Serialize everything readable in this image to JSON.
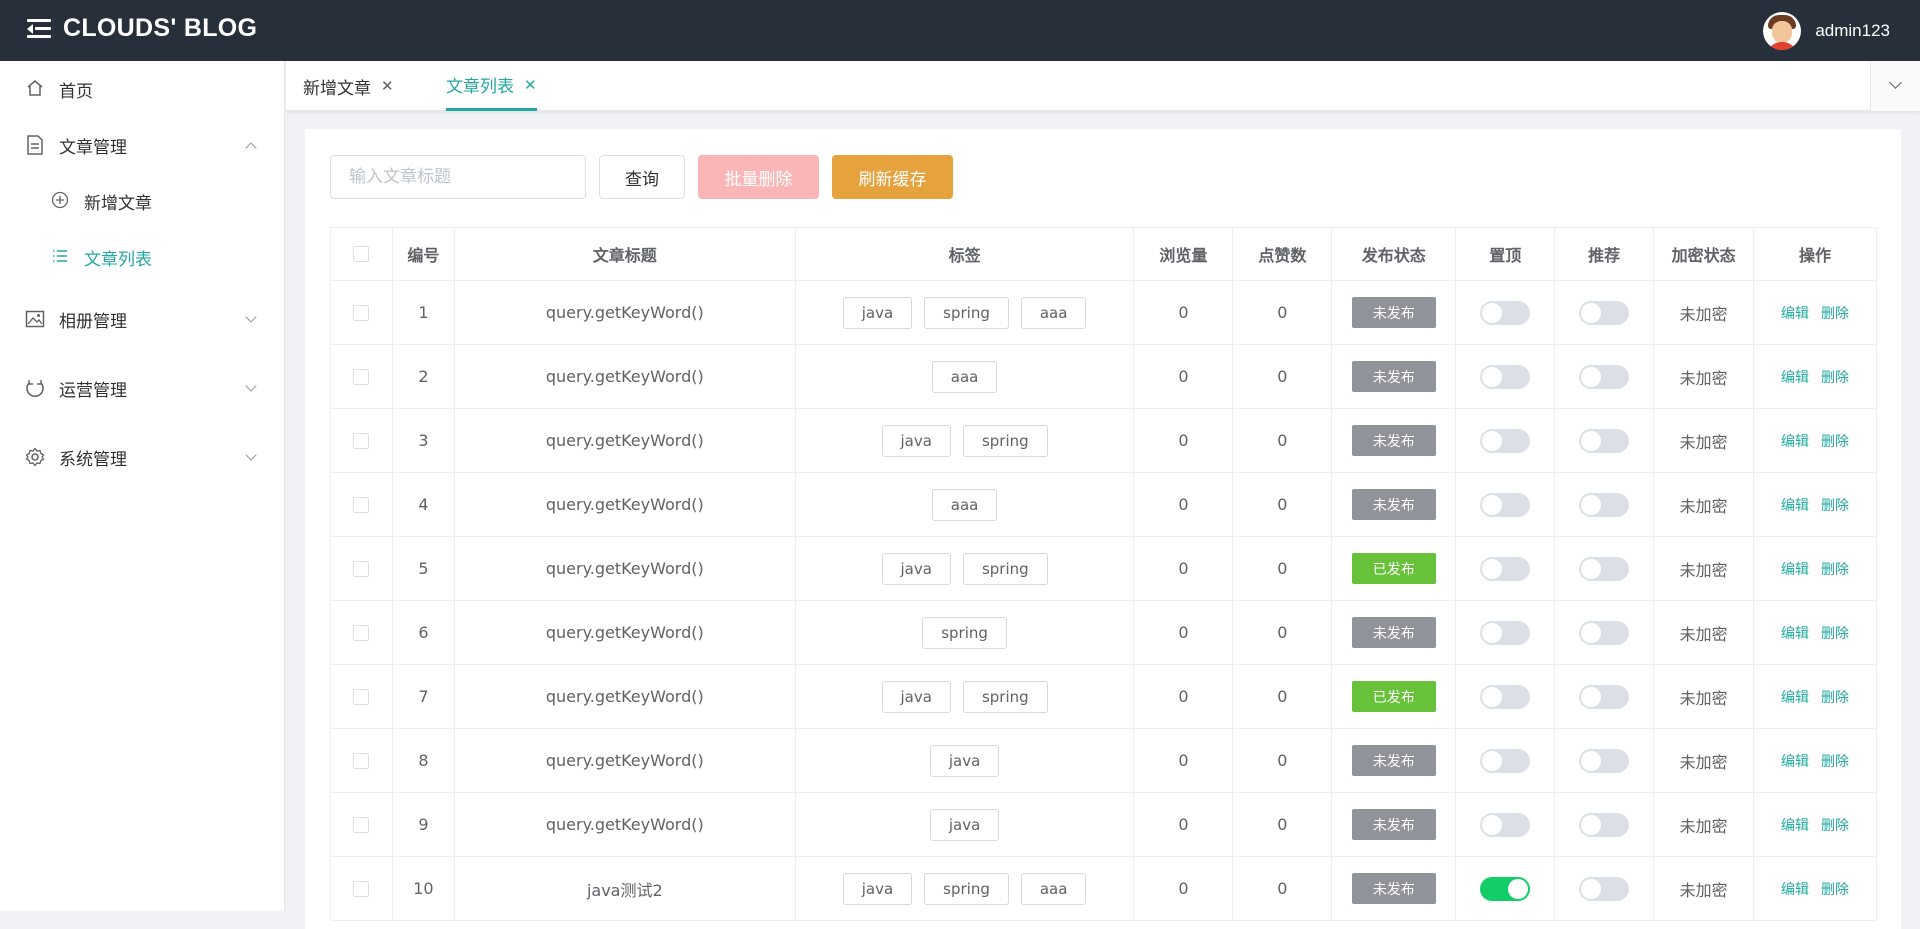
{
  "header": {
    "brand": "CLOUDS' BLOG",
    "username": "admin123"
  },
  "sidebar": {
    "items": [
      {
        "label": "首页",
        "icon": "home-icon"
      },
      {
        "label": "文章管理",
        "icon": "document-icon",
        "expanded": true
      },
      {
        "label": "新增文章",
        "icon": "plus-circle-icon"
      },
      {
        "label": "文章列表",
        "icon": "list-icon",
        "active": true
      },
      {
        "label": "相册管理",
        "icon": "picture-icon"
      },
      {
        "label": "运营管理",
        "icon": "operation-icon"
      },
      {
        "label": "系统管理",
        "icon": "gear-icon"
      }
    ]
  },
  "tabs": [
    {
      "label": "新增文章",
      "active": false
    },
    {
      "label": "文章列表",
      "active": true
    }
  ],
  "toolbar": {
    "search_placeholder": "输入文章标题",
    "query_label": "查询",
    "batch_delete_label": "批量删除",
    "refresh_label": "刷新缓存"
  },
  "table": {
    "headers": [
      "编号",
      "文章标题",
      "标签",
      "浏览量",
      "点赞数",
      "发布状态",
      "置顶",
      "推荐",
      "加密状态",
      "操作"
    ],
    "edit_label": "编辑",
    "delete_label": "删除",
    "rows": [
      {
        "id": "1",
        "title": "query.getKeyWord()",
        "tags": [
          "java",
          "spring",
          "aaa"
        ],
        "views": "0",
        "likes": "0",
        "status": "未发布",
        "published": false,
        "top": false,
        "recommend": false,
        "encrypt": "未加密"
      },
      {
        "id": "2",
        "title": "query.getKeyWord()",
        "tags": [
          "aaa"
        ],
        "views": "0",
        "likes": "0",
        "status": "未发布",
        "published": false,
        "top": false,
        "recommend": false,
        "encrypt": "未加密"
      },
      {
        "id": "3",
        "title": "query.getKeyWord()",
        "tags": [
          "java",
          "spring"
        ],
        "views": "0",
        "likes": "0",
        "status": "未发布",
        "published": false,
        "top": false,
        "recommend": false,
        "encrypt": "未加密"
      },
      {
        "id": "4",
        "title": "query.getKeyWord()",
        "tags": [
          "aaa"
        ],
        "views": "0",
        "likes": "0",
        "status": "未发布",
        "published": false,
        "top": false,
        "recommend": false,
        "encrypt": "未加密"
      },
      {
        "id": "5",
        "title": "query.getKeyWord()",
        "tags": [
          "java",
          "spring"
        ],
        "views": "0",
        "likes": "0",
        "status": "已发布",
        "published": true,
        "top": false,
        "recommend": false,
        "encrypt": "未加密"
      },
      {
        "id": "6",
        "title": "query.getKeyWord()",
        "tags": [
          "spring"
        ],
        "views": "0",
        "likes": "0",
        "status": "未发布",
        "published": false,
        "top": false,
        "recommend": false,
        "encrypt": "未加密"
      },
      {
        "id": "7",
        "title": "query.getKeyWord()",
        "tags": [
          "java",
          "spring"
        ],
        "views": "0",
        "likes": "0",
        "status": "已发布",
        "published": true,
        "top": false,
        "recommend": false,
        "encrypt": "未加密"
      },
      {
        "id": "8",
        "title": "query.getKeyWord()",
        "tags": [
          "java"
        ],
        "views": "0",
        "likes": "0",
        "status": "未发布",
        "published": false,
        "top": false,
        "recommend": false,
        "encrypt": "未加密"
      },
      {
        "id": "9",
        "title": "query.getKeyWord()",
        "tags": [
          "java"
        ],
        "views": "0",
        "likes": "0",
        "status": "未发布",
        "published": false,
        "top": false,
        "recommend": false,
        "encrypt": "未加密"
      },
      {
        "id": "10",
        "title": "java测试2",
        "tags": [
          "java",
          "spring",
          "aaa"
        ],
        "views": "0",
        "likes": "0",
        "status": "未发布",
        "published": false,
        "top": true,
        "recommend": false,
        "encrypt": "未加密"
      }
    ]
  },
  "colors": {
    "header_bg": "#262f3a",
    "accent": "#22a8a0",
    "published": "#67c23a",
    "unpublished": "#909399",
    "switch_on": "#13ce66",
    "refresh": "#e6a23c",
    "batch_delete": "#fab6b6"
  }
}
